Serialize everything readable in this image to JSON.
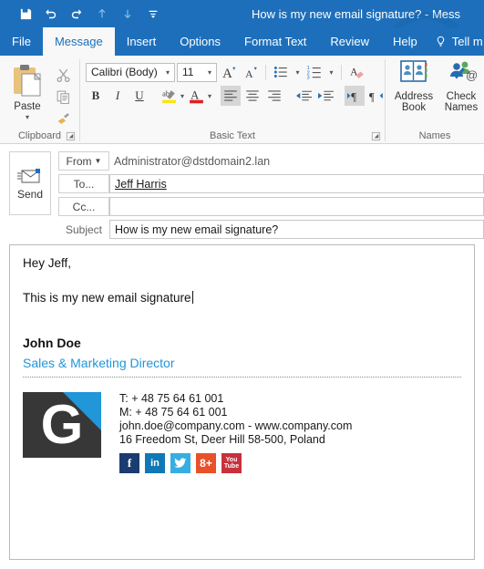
{
  "window": {
    "title": "How is my new email signature?  -  Mess",
    "accent_color": "#1d6fbb",
    "quick_access": [
      {
        "name": "save-icon",
        "label": "Save"
      },
      {
        "name": "undo-icon",
        "label": "Undo"
      },
      {
        "name": "redo-icon",
        "label": "Redo"
      },
      {
        "name": "previous-item-icon",
        "label": "Previous Item"
      },
      {
        "name": "next-item-icon",
        "label": "Next Item"
      },
      {
        "name": "customize-quick-access-toolbar-icon",
        "label": "Customize Quick Access Toolbar"
      }
    ]
  },
  "ribbon": {
    "tabs": [
      {
        "label": "File",
        "active": false
      },
      {
        "label": "Message",
        "active": true
      },
      {
        "label": "Insert",
        "active": false
      },
      {
        "label": "Options",
        "active": false
      },
      {
        "label": "Format Text",
        "active": false
      },
      {
        "label": "Review",
        "active": false
      },
      {
        "label": "Help",
        "active": false
      }
    ],
    "tell_me": "Tell m",
    "groups": {
      "clipboard": {
        "label": "Clipboard",
        "paste_label": "Paste",
        "cut_label": "Cut",
        "copy_label": "Copy",
        "format_painter_label": "Format Painter"
      },
      "basic_text": {
        "label": "Basic Text",
        "font_name": "Calibri (Body)",
        "font_size": "11",
        "grow_font_label": "A",
        "shrink_font_label": "A",
        "bold_label": "B",
        "italic_label": "I",
        "underline_label": "U",
        "highlight_label": "ab",
        "font_color_label": "A",
        "highlight_color": "#ffe400",
        "font_color": "#e02020",
        "bullets_label": "Bullets",
        "numbering_label": "Numbering",
        "clear_formatting_label": "Clear All Formatting",
        "align_left_label": "Align Left",
        "align_center_label": "Center",
        "align_right_label": "Align Right",
        "decrease_indent_label": "Decrease Indent",
        "increase_indent_label": "Increase Indent",
        "ltr_label": "Left-to-Right",
        "rtl_label": "Right-to-Left"
      },
      "names": {
        "label": "Names",
        "address_book_line1": "Address",
        "address_book_line2": "Book",
        "check_names_line1": "Check",
        "check_names_line2": "Names"
      }
    }
  },
  "compose": {
    "send_label": "Send",
    "from_label": "From",
    "from_value": "Administrator@dstdomain2.lan",
    "to_label": "To...",
    "to_value": "Jeff Harris",
    "cc_label": "Cc...",
    "cc_value": "",
    "subject_label": "Subject",
    "subject_value": "How is my new email signature?"
  },
  "body": {
    "greeting": "Hey Jeff,",
    "line_blank": "",
    "sentence": "This is my new email signature"
  },
  "signature": {
    "name": "John Doe",
    "title": "Sales & Marketing Director",
    "title_color": "#2196d8",
    "logo_letter": "G",
    "logo_bg": "#373737",
    "logo_wedge_color": "#2196d8",
    "contact": {
      "phone": "T: + 48 75 64 61 001",
      "mobile": "M: + 48 75 64 61 001",
      "email_web": "john.doe@company.com - www.company.com",
      "address": "16 Freedom St, Deer Hill 58-500, Poland"
    },
    "social": [
      {
        "name": "facebook-icon",
        "label": "f",
        "color": "#1a3c70"
      },
      {
        "name": "linkedin-icon",
        "label": "in",
        "color": "#1079b5"
      },
      {
        "name": "twitter-icon",
        "label": "",
        "color": "#37aee2"
      },
      {
        "name": "googleplus-icon",
        "label": "8+",
        "color": "#e8512a"
      },
      {
        "name": "youtube-icon",
        "label": "You Tube",
        "color": "#c8313c"
      }
    ]
  }
}
